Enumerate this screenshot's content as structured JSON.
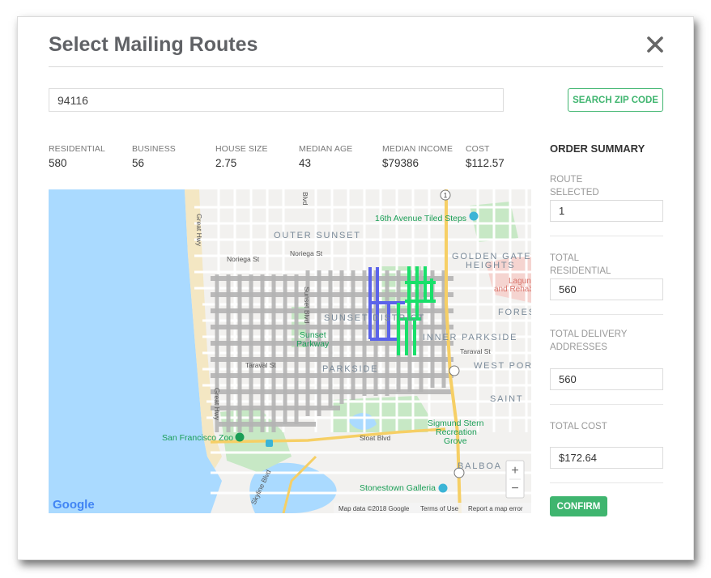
{
  "modal": {
    "title": "Select Mailing Routes",
    "close_icon": "close-icon"
  },
  "search": {
    "value": "94116",
    "button_label": "SEARCH ZIP CODE"
  },
  "stats": [
    {
      "label": "RESIDENTIAL",
      "value": "580"
    },
    {
      "label": "BUSINESS",
      "value": "56"
    },
    {
      "label": "HOUSE SIZE",
      "value": "2.75"
    },
    {
      "label": "MEDIAN AGE",
      "value": "43"
    },
    {
      "label": "MEDIAN INCOME",
      "value": "$79386"
    },
    {
      "label": "COST",
      "value": "$112.57"
    }
  ],
  "order_summary": {
    "title": "ORDER SUMMARY",
    "route_selected": {
      "label": "ROUTE SELECTED",
      "value": "1"
    },
    "total_residential": {
      "label": "TOTAL RESIDENTIAL",
      "value": "560"
    },
    "total_delivery": {
      "label": "TOTAL DELIVERY ADDRESSES",
      "value": "560"
    },
    "total_cost": {
      "label": "TOTAL COST",
      "value": "$172.64"
    },
    "confirm_label": "CONFIRM"
  },
  "map": {
    "labels": {
      "outer_sunset": "OUTER SUNSET",
      "sunset_district": "SUNSET DISTRICT",
      "parkside": "PARKSIDE",
      "inner_parkside": "INNER PARKSIDE",
      "golden_gate_1": "GOLDEN GATE",
      "golden_gate_2": "HEIGHTS",
      "fores": "FORES",
      "west_por": "WEST POR",
      "saint": "SAINT",
      "balboa": "BALBOA",
      "tiled_steps": "16th Avenue Tiled Steps",
      "laguna_1": "Laguna",
      "laguna_2": "and Rehab",
      "sunset_parkway_1": "Sunset",
      "sunset_parkway_2": "Parkway",
      "zoo": "San Francisco Zoo",
      "sigmund_1": "Sigmund Stern",
      "sigmund_2": "Recreation",
      "sigmund_3": "Grove",
      "stonestown": "Stonestown Galleria",
      "noriega_1": "Noriega St",
      "noriega_2": "Noriega St",
      "taraval_1": "Taraval St",
      "taraval_2": "Taraval St",
      "sloat": "Sloat Blvd",
      "great_hwy_1": "Great Hwy",
      "great_hwy_2": "Great Hwy",
      "skyline": "Skyline Blvd",
      "sunset_blvd": "Sunset Blvd",
      "blvd_top": "Blvd",
      "route_1": "1"
    },
    "zoom_in": "+",
    "zoom_out": "−",
    "google": "Google",
    "attribution": "Map data ©2018 Google",
    "terms": "Terms of Use",
    "report": "Report a map error",
    "colors": {
      "water": "#aadaff",
      "land": "#f2f1ef",
      "park": "#c7e8c5",
      "beach": "#f4e7c3",
      "road": "#ffffff",
      "highway": "#f6cf65",
      "route_gray": "#b4b4b4",
      "route_blue": "#5b63ea",
      "route_green": "#19e06a"
    }
  }
}
